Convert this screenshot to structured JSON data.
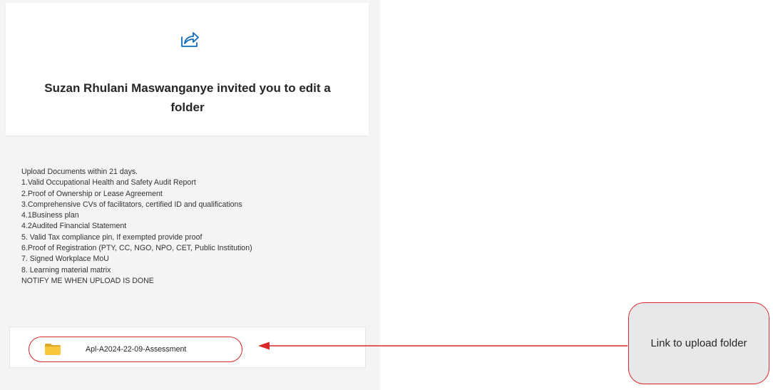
{
  "invite": {
    "icon": "share-icon",
    "title": "Suzan Rhulani Maswanganye invited you to edit a folder"
  },
  "message": {
    "lines": [
      "Upload Documents within 21 days.",
      "1.Valid Occupational Health and Safety Audit Report",
      "2.Proof of Ownership or Lease Agreement",
      "3.Comprehensive CVs of facilitators, certified ID and qualifications",
      "4.1Business plan",
      "4.2Audited Financial Statement",
      "5. Valid Tax compliance pin, If exempted provide proof",
      "6.Proof of Registration (PTY, CC, NGO, NPO, CET, Public Institution)",
      "7. Signed Workplace MoU",
      "8. Learning material matrix",
      "NOTIFY ME WHEN UPLOAD IS DONE"
    ]
  },
  "folder": {
    "icon": "folder-icon",
    "name": "Apl-A2024-22-09-Assessment"
  },
  "annotation": {
    "callout_text": "Link to upload folder",
    "highlight_color": "#d92828"
  },
  "colors": {
    "accent": "#0f6cbd",
    "folder": "#f8c73b",
    "annotation": "#d92828",
    "panel_background": "#f4f4f4"
  }
}
